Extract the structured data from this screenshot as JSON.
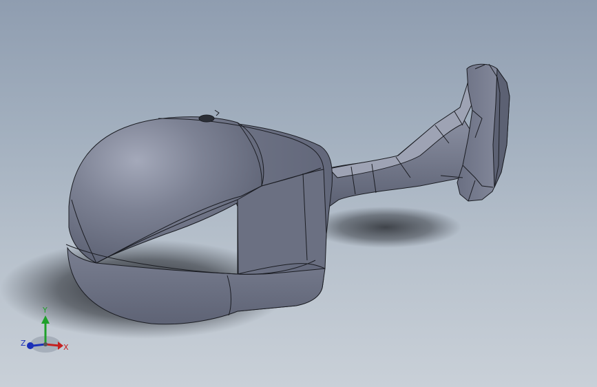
{
  "viewport": {
    "background_top": "#8f9db0",
    "background_bottom": "#c9d0d8"
  },
  "model": {
    "surface_color": "#6e7384",
    "highlight_color": "#a0a5b6",
    "edge_color": "#1a1c22"
  },
  "triad": {
    "y_label": "Y",
    "x_label": "X",
    "z_label": "Z",
    "y_color": "#1fa02a",
    "x_color": "#c42020",
    "z_color": "#1a2fb8"
  }
}
